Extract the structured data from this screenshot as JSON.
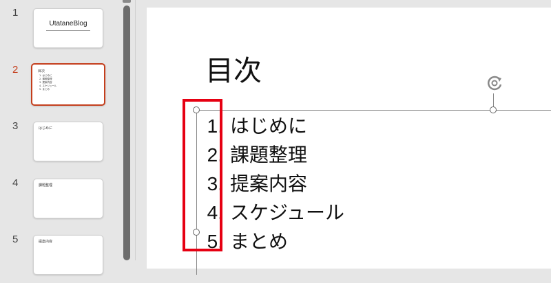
{
  "slides": [
    {
      "number": "1",
      "thumb_title": "UtataneBlog"
    },
    {
      "number": "2",
      "thumb_title": "目次",
      "thumb_items": [
        "1. はじめに",
        "2. 課題整理",
        "3. 提案内容",
        "4. スケジュール",
        "5. まとめ"
      ]
    },
    {
      "number": "3",
      "thumb_title": "はじめに"
    },
    {
      "number": "4",
      "thumb_title": "課題整理"
    },
    {
      "number": "5",
      "thumb_title": "提案内容"
    }
  ],
  "slide": {
    "title": "目次",
    "items": [
      {
        "num": "1.",
        "text": "はじめに"
      },
      {
        "num": "2.",
        "text": "課題整理"
      },
      {
        "num": "3.",
        "text": "提案内容"
      },
      {
        "num": "4.",
        "text": "スケジュール"
      },
      {
        "num": "5.",
        "text": "まとめ"
      }
    ]
  },
  "colors": {
    "active": "#c43e1c",
    "highlight": "#e60012"
  },
  "icons": {
    "rotate_handle": "rotate-handle-icon"
  }
}
